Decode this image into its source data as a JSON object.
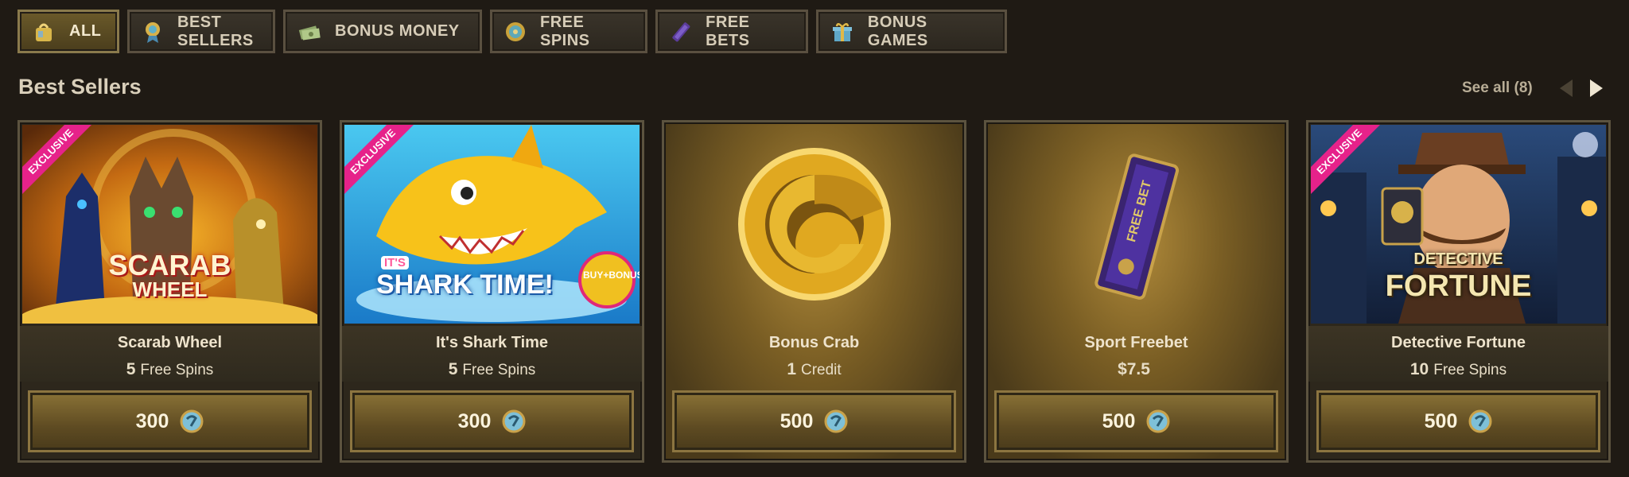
{
  "tabs": [
    {
      "label": "ALL",
      "icon": "bag-icon",
      "active": true
    },
    {
      "label": "BEST SELLERS",
      "icon": "medal-icon"
    },
    {
      "label": "BONUS MONEY",
      "icon": "money-icon"
    },
    {
      "label": "FREE SPINS",
      "icon": "spin-icon"
    },
    {
      "label": "FREE BETS",
      "icon": "ticket-icon"
    },
    {
      "label": "BONUS GAMES",
      "icon": "gift-icon"
    }
  ],
  "section": {
    "title": "Best Sellers",
    "see_all": "See all (8)"
  },
  "cards": [
    {
      "name": "Scarab Wheel",
      "amount": "5",
      "unit": "Free Spins",
      "price": "300",
      "badge": "EXCLUSIVE",
      "art_text_1": "SCARAB",
      "art_text_2": "WHEEL"
    },
    {
      "name": "It's Shark Time",
      "amount": "5",
      "unit": "Free Spins",
      "price": "300",
      "badge": "EXCLUSIVE",
      "art_text_1": "IT'S",
      "art_text_2": "SHARK TIME!",
      "art_text_3": "BUY+BONUS"
    },
    {
      "name": "Bonus Crab",
      "amount": "1",
      "unit": "Credit",
      "price": "500"
    },
    {
      "name": "Sport Freebet",
      "amount": "$7.5",
      "unit": "",
      "price": "500",
      "art_text_1": "FREE BET"
    },
    {
      "name": "Detective Fortune",
      "amount": "10",
      "unit": "Free Spins",
      "price": "500",
      "badge": "EXCLUSIVE",
      "art_text_1": "DETECTIVE",
      "art_text_2": "FORTUNE"
    }
  ],
  "colors": {
    "accent_gold": "#c9a24a",
    "ribbon": "#e6228a",
    "background": "#1f1a14"
  }
}
